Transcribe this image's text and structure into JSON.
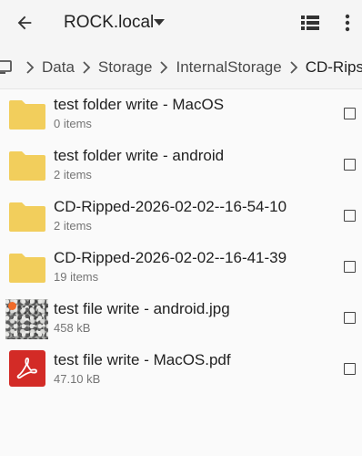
{
  "toolbar": {
    "title": "ROCK.local",
    "back_icon": "arrow-left-icon",
    "dropdown_icon": "caret-down-icon",
    "view_icon": "list-view-icon",
    "more_icon": "more-vert-icon"
  },
  "breadcrumb": {
    "device_icon": "monitor-icon",
    "separator_icon": "chevron-right-icon",
    "items": [
      "Data",
      "Storage",
      "InternalStorage",
      "CD-Rips"
    ]
  },
  "files": [
    {
      "name": "test folder write - MacOS",
      "detail": "0 items",
      "icon": "folder-icon"
    },
    {
      "name": "test folder write - android",
      "detail": "2 items",
      "icon": "folder-icon"
    },
    {
      "name": "CD-Ripped-2026-02-02--16-54-10",
      "detail": "2 items",
      "icon": "folder-icon"
    },
    {
      "name": "CD-Ripped-2026-02-02--16-41-39",
      "detail": "19 items",
      "icon": "folder-icon"
    },
    {
      "name": "test file write - android.jpg",
      "detail": "458 kB",
      "icon": "image-thumbnail"
    },
    {
      "name": "test file write - MacOS.pdf",
      "detail": "47.10 kB",
      "icon": "pdf-icon"
    }
  ],
  "colors": {
    "folder": "#f2ce5c",
    "pdf_red": "#d32b26",
    "background": "#fafafa",
    "text_primary": "#212121",
    "text_secondary": "#757575"
  }
}
